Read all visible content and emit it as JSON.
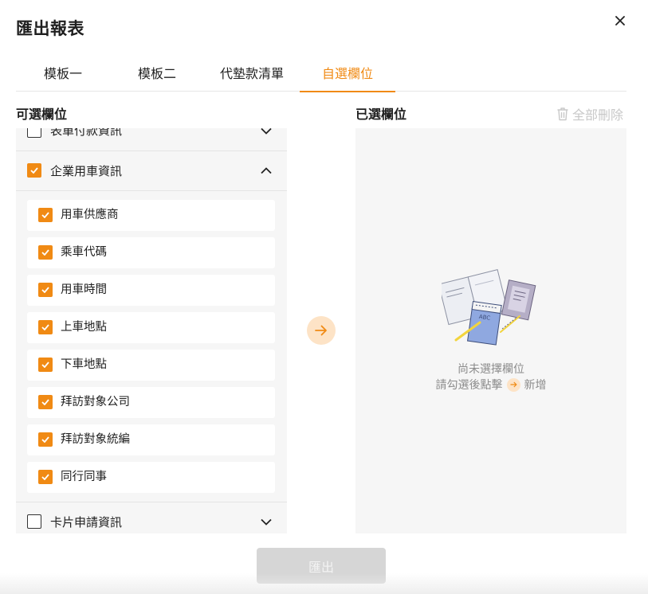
{
  "dialog": {
    "title": "匯出報表"
  },
  "tabs": [
    {
      "label": "模板一",
      "active": false
    },
    {
      "label": "模板二",
      "active": false
    },
    {
      "label": "代墊款清單",
      "active": false
    },
    {
      "label": "自選欄位",
      "active": true
    }
  ],
  "available": {
    "heading": "可選欄位",
    "groups": [
      {
        "label": "表單付款資訊",
        "checked": false,
        "expanded": false
      },
      {
        "label": "企業用車資訊",
        "checked": true,
        "expanded": true,
        "children": [
          "用車供應商",
          "乘車代碼",
          "用車時間",
          "上車地點",
          "下車地點",
          "拜訪對象公司",
          "拜訪對象統編",
          "同行同事"
        ]
      },
      {
        "label": "卡片申請資訊",
        "checked": false,
        "expanded": false
      }
    ]
  },
  "selected": {
    "heading": "已選欄位",
    "clear_all_label": "全部刪除",
    "empty_line1": "尚未選擇欄位",
    "empty_line2_prefix": "請勾選後點擊",
    "empty_line2_suffix": "新增"
  },
  "footer": {
    "export_label": "匯出"
  },
  "colors": {
    "accent": "#f08a14",
    "accent_soft": "#fde3c6",
    "panel_bg": "#f6f6f6",
    "disabled": "#d6d6d6"
  },
  "icons": {
    "close": "close-icon",
    "clear_all": "trash-icon",
    "move": "arrow-right-icon"
  }
}
